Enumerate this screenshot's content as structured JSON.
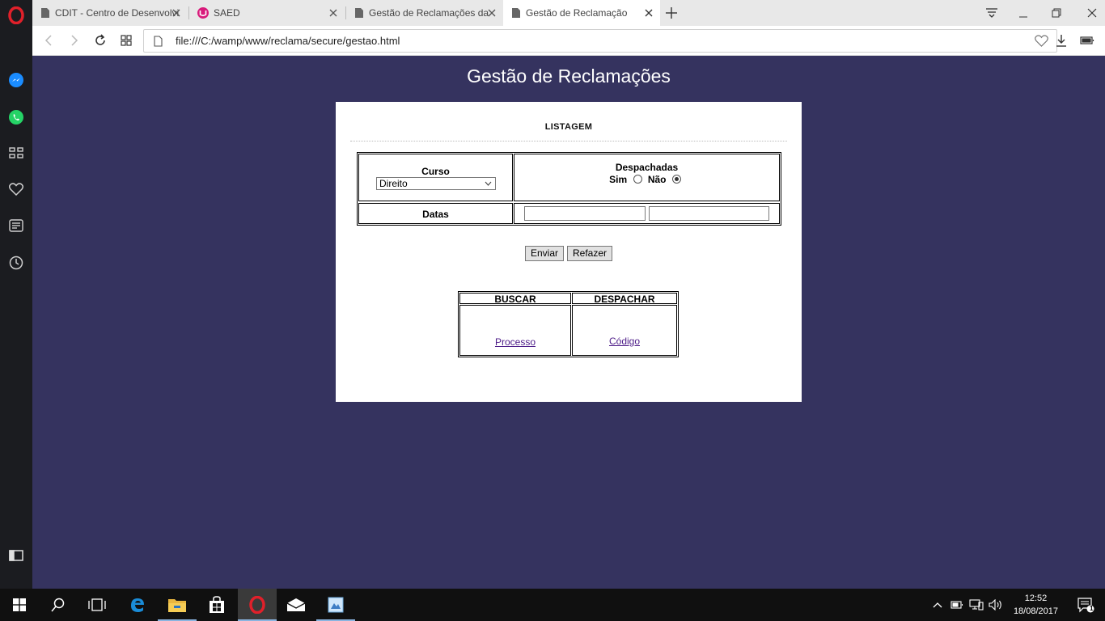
{
  "browser": {
    "tabs": [
      {
        "title": "CDIT - Centro de Desenvolvi"
      },
      {
        "title": "SAED"
      },
      {
        "title": "Gestão de Reclamações da"
      },
      {
        "title": "Gestão de Reclamação"
      }
    ],
    "url": "file:///C:/wamp/www/reclama/secure/gestao.html"
  },
  "page": {
    "title": "Gestão de Reclamações",
    "section_title": "LISTAGEM",
    "form": {
      "curso_label": "Curso",
      "curso_selected": "Direito",
      "despachadas_label": "Despachadas",
      "sim_label": "Sim",
      "nao_label": "Não",
      "datas_label": "Datas",
      "date_from_value": "",
      "date_to_value": ""
    },
    "buttons": {
      "submit": "Enviar",
      "reset": "Refazer"
    },
    "actions_table": {
      "headers": [
        "BUSCAR",
        "DESPACHAR"
      ],
      "links": [
        "Processo",
        "Código"
      ]
    }
  },
  "taskbar": {
    "time": "12:52",
    "date": "18/08/2017",
    "notification_count": "1"
  },
  "colors": {
    "page_background": "#35335f",
    "link": "#4b1a87",
    "opera_red": "#e0202a"
  }
}
